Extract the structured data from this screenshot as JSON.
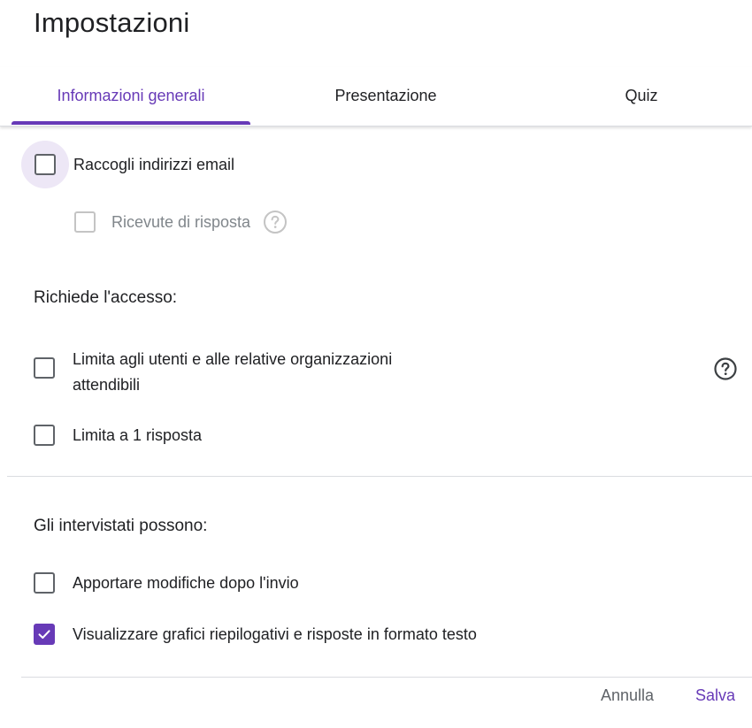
{
  "dialog": {
    "title": "Impostazioni"
  },
  "tabs": [
    {
      "label": "Informazioni generali",
      "active": true
    },
    {
      "label": "Presentazione",
      "active": false
    },
    {
      "label": "Quiz",
      "active": false
    }
  ],
  "general": {
    "collect_email": {
      "label": "Raccogli indirizzi email",
      "checked": false
    },
    "response_receipts": {
      "label": "Ricevute di risposta",
      "checked": false,
      "disabled": true,
      "help_icon": "help-circle-icon"
    }
  },
  "access": {
    "heading": "Richiede l'accesso:",
    "restrict_org": {
      "label_line1": "Limita agli utenti e alle relative organizzazioni",
      "label_line2": "attendibili",
      "checked": false,
      "help_icon": "help-circle-icon"
    },
    "limit_one": {
      "label": "Limita a 1 risposta",
      "checked": false
    }
  },
  "respondents": {
    "heading": "Gli intervistati possono:",
    "edit_after_submit": {
      "label": "Apportare modifiche dopo l'invio",
      "checked": false
    },
    "see_summary": {
      "label": "Visualizzare grafici riepilogativi e risposte in formato testo",
      "checked": true
    }
  },
  "footer": {
    "cancel_label": "Annulla",
    "save_label": "Salva"
  },
  "colors": {
    "accent": "#673ab7",
    "focus_halo": "#ede7f6",
    "text": "#202124",
    "muted": "#5f6368",
    "divider": "#dadce0"
  }
}
